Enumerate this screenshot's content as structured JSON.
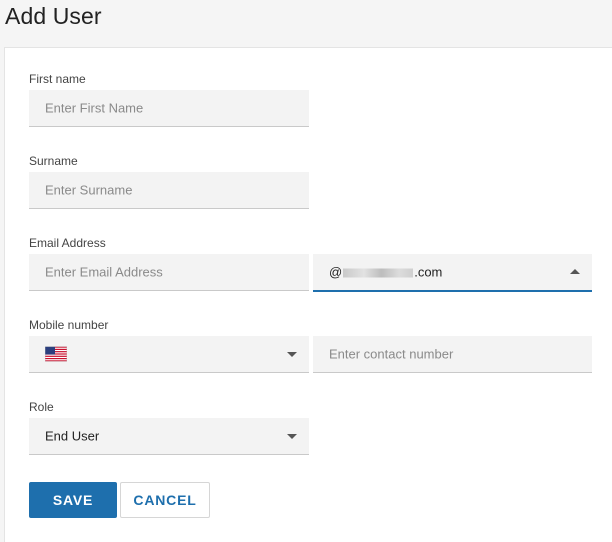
{
  "page": {
    "title": "Add User"
  },
  "form": {
    "first_name": {
      "label": "First name",
      "placeholder": "Enter First Name"
    },
    "surname": {
      "label": "Surname",
      "placeholder": "Enter Surname"
    },
    "email": {
      "label": "Email Address",
      "placeholder": "Enter Email Address",
      "domain_prefix": "@",
      "domain_suffix": ".com"
    },
    "mobile": {
      "label": "Mobile number",
      "country_flag": "us-flag-icon",
      "placeholder": "Enter contact number"
    },
    "role": {
      "label": "Role",
      "value": "End User"
    }
  },
  "actions": {
    "save_label": "SAVE",
    "cancel_label": "CANCEL"
  },
  "colors": {
    "accent": "#1e6fad",
    "field_bg": "#f3f3f3",
    "page_bg": "#f5f5f5"
  }
}
